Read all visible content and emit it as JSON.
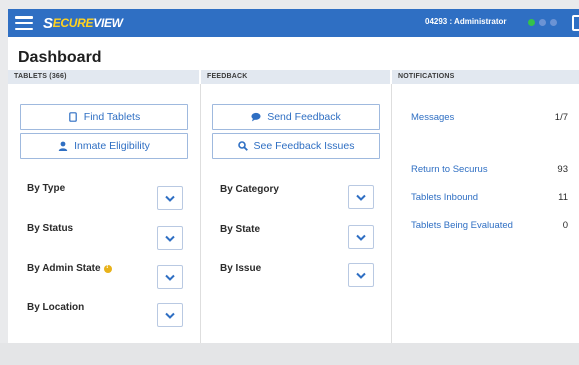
{
  "header": {
    "logo_prefix": "S",
    "logo_cure": "ECURE",
    "logo_view": "VIEW",
    "user": "04293 : Administrator",
    "accent": "#2f6fc3",
    "status_colors": [
      "#35c24a",
      "#6b93d4",
      "#6b93d4"
    ]
  },
  "page": {
    "title": "Dashboard"
  },
  "tablets": {
    "header": "TABLETS (366)",
    "buttons": [
      {
        "label": "Find Tablets",
        "icon": "tablet-icon"
      },
      {
        "label": "Inmate Eligibility",
        "icon": "user-icon"
      }
    ],
    "filters": [
      {
        "label": "By Type"
      },
      {
        "label": "By Status"
      },
      {
        "label": "By Admin State",
        "badge": "warning-icon"
      },
      {
        "label": "By Location"
      }
    ]
  },
  "feedback": {
    "header": "FEEDBACK",
    "buttons": [
      {
        "label": "Send Feedback",
        "icon": "chat-icon"
      },
      {
        "label": "See Feedback Issues",
        "icon": "search-icon"
      }
    ],
    "filters": [
      {
        "label": "By Category"
      },
      {
        "label": "By State"
      },
      {
        "label": "By Issue"
      }
    ]
  },
  "notifications": {
    "header": "NOTIFICATIONS",
    "items": [
      {
        "label": "Messages",
        "value": "1/7"
      },
      {
        "label": "Return to Securus",
        "value": "93"
      },
      {
        "label": "Tablets Inbound",
        "value": "11"
      },
      {
        "label": "Tablets Being Evaluated",
        "value": "0"
      }
    ]
  }
}
